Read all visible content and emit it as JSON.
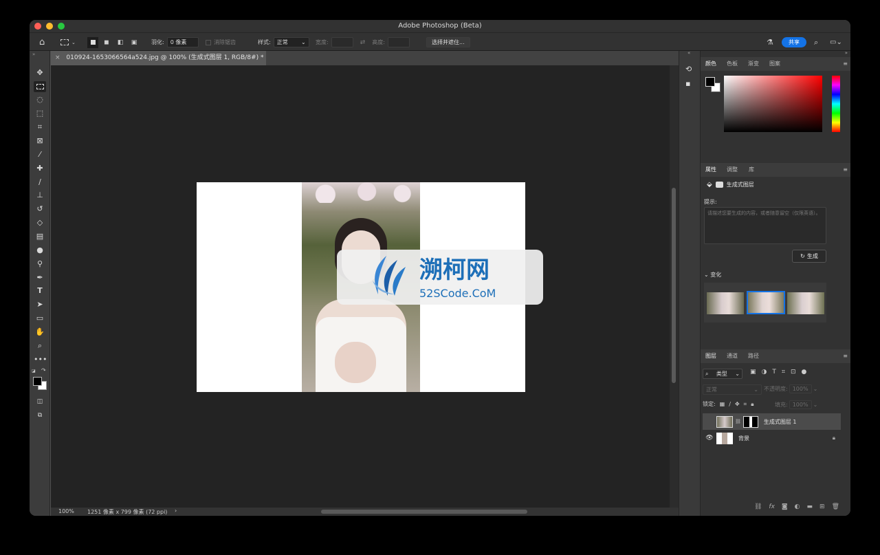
{
  "window": {
    "title": "Adobe Photoshop (Beta)"
  },
  "options": {
    "feather_label": "羽化:",
    "feather_value": "0 像素",
    "antialias_label": "消除锯齿",
    "style_label": "样式:",
    "style_value": "正常",
    "width_label": "宽度:",
    "height_label": "高度:",
    "select_mask": "选择并遮住...",
    "share": "共享"
  },
  "document": {
    "tab_title": "010924-1653066564a524.jpg @ 100% (生成式图层 1, RGB/8#) *"
  },
  "watermark": {
    "title": "溯柯网",
    "url": "52SCode.CoM"
  },
  "status": {
    "zoom": "100%",
    "size": "1251 像素 x 799 像素 (72 ppi)"
  },
  "color_panel": {
    "tabs": [
      "颜色",
      "色板",
      "渐变",
      "图案"
    ]
  },
  "properties_panel": {
    "tabs": [
      "属性",
      "调整",
      "库"
    ],
    "layer_type": "生成式图层",
    "prompt_label": "提示:",
    "prompt_placeholder": "请描述您要生成的内容，或者随意留空（仅限英语）。",
    "generate": "生成",
    "variations": "变化"
  },
  "layers_panel": {
    "tabs": [
      "图层",
      "通道",
      "路径"
    ],
    "filter": "类型",
    "blend_mode": "正常",
    "opacity_label": "不透明度:",
    "opacity_value": "100%",
    "lock_label": "锁定:",
    "fill_label": "填充:",
    "fill_value": "100%",
    "layers": [
      {
        "name": "生成式图层 1"
      },
      {
        "name": "背景"
      }
    ]
  },
  "colors": {
    "accent": "#1473e6",
    "canvas_bg": "#232323",
    "panel_bg": "#323232",
    "watermark_text": "#1d6fb8"
  }
}
